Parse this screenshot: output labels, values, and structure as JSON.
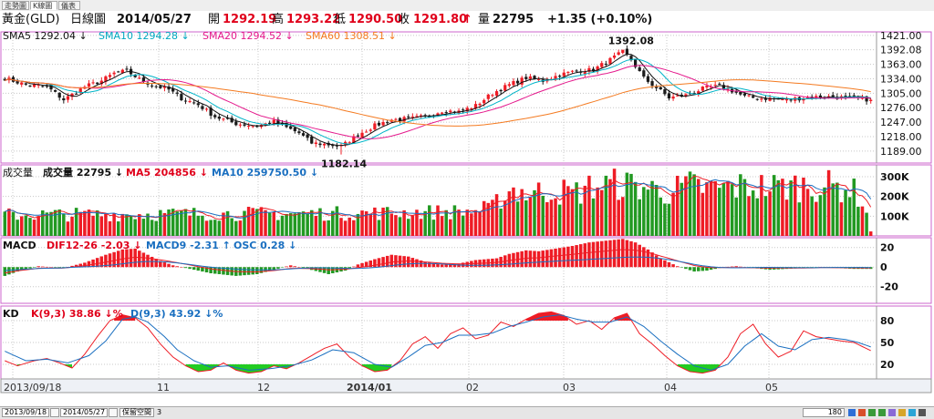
{
  "tabs": [
    "走勢圖",
    "K線圖",
    "儀表"
  ],
  "quote": {
    "name": "黃金(GLD)",
    "chart_type": "日線圖",
    "date": "2014/05/27",
    "open_label": "開",
    "open": "1292.19",
    "high_label": "高",
    "high": "1293.22",
    "low_label": "低",
    "low": "1290.50",
    "close_label": "收",
    "close": "1291.80",
    "volume_label": "量",
    "volume": "22795",
    "change": "+1.35 (+0.10%)"
  },
  "colors": {
    "up": "#ee1c25",
    "down": "#1a1a1a",
    "vol_up": "#ee1c25",
    "vol_down": "#229922",
    "sma5": "#111111",
    "sma10": "#00b4c8",
    "sma20": "#e4198c",
    "sma60": "#f47a20",
    "frame": "#cc66cc",
    "grid": "#c8c8c8"
  },
  "panels": {
    "price": {
      "legend": [
        {
          "text": "SMA5 1292.04",
          "arrow": "↓",
          "color": "#111111"
        },
        {
          "text": "SMA10 1294.28",
          "arrow": "↓",
          "color": "#00a8c0"
        },
        {
          "text": "SMA20 1294.52",
          "arrow": "↓",
          "color": "#e4198c"
        },
        {
          "text": "SMA60 1308.51",
          "arrow": "↓",
          "color": "#f47a20"
        }
      ],
      "high_label": "1392.08",
      "low_label": "1182.14"
    },
    "volume": {
      "title": "成交量",
      "legend": [
        {
          "text": "成交量 22795",
          "arrow": "↓",
          "color": "#111111"
        },
        {
          "text": "MA5 204856",
          "arrow": "↓",
          "color": "#e0001b"
        },
        {
          "text": "MA10 259750.50",
          "arrow": "↓",
          "color": "#1a6fc0"
        }
      ]
    },
    "macd": {
      "title": "MACD",
      "legend": [
        {
          "text": "DIF12-26 -2.03",
          "arrow": "↓",
          "color": "#e0001b"
        },
        {
          "text": "MACD9 -2.31",
          "arrow": "↑",
          "color": "#1a6fc0"
        },
        {
          "text": "OSC 0.28",
          "arrow": "↓",
          "color": "#1a6fc0"
        }
      ]
    },
    "kd": {
      "title": "KD",
      "legend": [
        {
          "text": "K(9,3) 38.86",
          "arrow": "↓%",
          "color": "#e0001b"
        },
        {
          "text": "D(9,3) 43.92",
          "arrow": "↓%",
          "color": "#1a6fc0"
        }
      ]
    }
  },
  "footer": {
    "start": "2013/09/18",
    "end": "2014/05/27",
    "button": "保留空間",
    "count": "3",
    "zoom": "180"
  },
  "chart_data": {
    "type": "candlestick",
    "x_tick_labels": [
      "2013/09/18",
      "11",
      "12",
      "2014/01",
      "02",
      "03",
      "04",
      "05"
    ],
    "price_axis": {
      "ticks": [
        1421.0,
        1392.08,
        1363.0,
        1334.0,
        1305.0,
        1276.0,
        1247.0,
        1218.0,
        1189.0
      ],
      "ylim": [
        1165,
        1428
      ]
    },
    "volume_axis": {
      "ticks": [
        "100K",
        "200K",
        "300K"
      ],
      "ylim": [
        0,
        360000
      ]
    },
    "macd_axis": {
      "ticks": [
        20,
        0,
        -20
      ],
      "ylim": [
        -37,
        30
      ]
    },
    "kd_axis": {
      "ticks": [
        20,
        50,
        80
      ],
      "ylim": [
        0,
        100
      ]
    },
    "close_anchors": [
      [
        0,
        1335
      ],
      [
        5,
        1322
      ],
      [
        10,
        1318
      ],
      [
        14,
        1292
      ],
      [
        19,
        1318
      ],
      [
        23,
        1330
      ],
      [
        26,
        1345
      ],
      [
        29,
        1350
      ],
      [
        32,
        1333
      ],
      [
        35,
        1322
      ],
      [
        39,
        1312
      ],
      [
        42,
        1295
      ],
      [
        46,
        1282
      ],
      [
        50,
        1258
      ],
      [
        55,
        1244
      ],
      [
        60,
        1239
      ],
      [
        64,
        1248
      ],
      [
        67,
        1236
      ],
      [
        70,
        1225
      ],
      [
        73,
        1205
      ],
      [
        77,
        1202
      ],
      [
        80,
        1198
      ],
      [
        84,
        1222
      ],
      [
        88,
        1240
      ],
      [
        92,
        1252
      ],
      [
        96,
        1254
      ],
      [
        100,
        1258
      ],
      [
        104,
        1270
      ],
      [
        108,
        1268
      ],
      [
        112,
        1280
      ],
      [
        116,
        1305
      ],
      [
        120,
        1322
      ],
      [
        124,
        1336
      ],
      [
        128,
        1330
      ],
      [
        132,
        1342
      ],
      [
        136,
        1350
      ],
      [
        140,
        1352
      ],
      [
        144,
        1372
      ],
      [
        147,
        1388
      ],
      [
        149,
        1372
      ],
      [
        152,
        1335
      ],
      [
        155,
        1316
      ],
      [
        158,
        1296
      ],
      [
        162,
        1301
      ],
      [
        166,
        1314
      ],
      [
        170,
        1320
      ],
      [
        173,
        1310
      ],
      [
        176,
        1298
      ],
      [
        179,
        1295
      ],
      [
        183,
        1294
      ],
      [
        186,
        1292
      ],
      [
        190,
        1296
      ],
      [
        194,
        1298
      ],
      [
        198,
        1297
      ],
      [
        202,
        1295
      ],
      [
        206,
        1292
      ]
    ],
    "volume_anchors": [
      [
        0,
        130000
      ],
      [
        40,
        135000
      ],
      [
        80,
        138000
      ],
      [
        110,
        150000
      ],
      [
        116,
        170000
      ],
      [
        118,
        240000
      ],
      [
        121,
        290000
      ],
      [
        125,
        255000
      ],
      [
        130,
        285000
      ],
      [
        135,
        260000
      ],
      [
        140,
        305000
      ],
      [
        146,
        320000
      ],
      [
        152,
        300000
      ],
      [
        158,
        270000
      ],
      [
        163,
        310000
      ],
      [
        168,
        290000
      ],
      [
        173,
        300000
      ],
      [
        178,
        305000
      ],
      [
        183,
        300000
      ],
      [
        190,
        310000
      ],
      [
        196,
        305000
      ],
      [
        201,
        295000
      ],
      [
        204,
        220000
      ],
      [
        205,
        130000
      ],
      [
        206,
        22795
      ]
    ],
    "macd_anchors": [
      [
        0,
        -10
      ],
      [
        3,
        -5
      ],
      [
        8,
        1
      ],
      [
        14,
        -1
      ],
      [
        19,
        5
      ],
      [
        24,
        14
      ],
      [
        28,
        20
      ],
      [
        31,
        21
      ],
      [
        34,
        14
      ],
      [
        37,
        7
      ],
      [
        40,
        2
      ],
      [
        44,
        -2
      ],
      [
        49,
        -7
      ],
      [
        55,
        -10
      ],
      [
        60,
        -8
      ],
      [
        64,
        -3
      ],
      [
        68,
        2
      ],
      [
        72,
        -2
      ],
      [
        77,
        -8
      ],
      [
        81,
        -4
      ],
      [
        84,
        3
      ],
      [
        88,
        9
      ],
      [
        92,
        14
      ],
      [
        96,
        12
      ],
      [
        100,
        6
      ],
      [
        104,
        3
      ],
      [
        108,
        4
      ],
      [
        112,
        8
      ],
      [
        117,
        10
      ],
      [
        120,
        15
      ],
      [
        124,
        19
      ],
      [
        127,
        18
      ],
      [
        131,
        21
      ],
      [
        135,
        24
      ],
      [
        139,
        28
      ],
      [
        143,
        30
      ],
      [
        147,
        32
      ],
      [
        150,
        28
      ],
      [
        153,
        20
      ],
      [
        156,
        10
      ],
      [
        160,
        1
      ],
      [
        164,
        -5
      ],
      [
        167,
        -4
      ],
      [
        171,
        0
      ],
      [
        174,
        1
      ],
      [
        178,
        -1
      ],
      [
        182,
        -3
      ],
      [
        186,
        -2
      ],
      [
        190,
        -1
      ],
      [
        194,
        0
      ],
      [
        198,
        -1
      ],
      [
        202,
        -2
      ],
      [
        206,
        -2.03
      ]
    ],
    "k_anchors": [
      [
        0,
        25
      ],
      [
        3,
        18
      ],
      [
        7,
        25
      ],
      [
        10,
        28
      ],
      [
        13,
        22
      ],
      [
        16,
        15
      ],
      [
        19,
        34
      ],
      [
        22,
        58
      ],
      [
        25,
        80
      ],
      [
        28,
        88
      ],
      [
        31,
        84
      ],
      [
        34,
        70
      ],
      [
        37,
        48
      ],
      [
        40,
        30
      ],
      [
        43,
        18
      ],
      [
        46,
        10
      ],
      [
        49,
        12
      ],
      [
        52,
        22
      ],
      [
        55,
        12
      ],
      [
        58,
        8
      ],
      [
        61,
        10
      ],
      [
        64,
        18
      ],
      [
        67,
        14
      ],
      [
        70,
        22
      ],
      [
        73,
        32
      ],
      [
        76,
        42
      ],
      [
        79,
        48
      ],
      [
        82,
        30
      ],
      [
        85,
        18
      ],
      [
        88,
        10
      ],
      [
        91,
        12
      ],
      [
        94,
        25
      ],
      [
        97,
        48
      ],
      [
        100,
        58
      ],
      [
        103,
        42
      ],
      [
        106,
        62
      ],
      [
        109,
        70
      ],
      [
        112,
        55
      ],
      [
        115,
        60
      ],
      [
        118,
        78
      ],
      [
        121,
        72
      ],
      [
        124,
        82
      ],
      [
        127,
        90
      ],
      [
        130,
        92
      ],
      [
        133,
        87
      ],
      [
        136,
        75
      ],
      [
        139,
        80
      ],
      [
        142,
        68
      ],
      [
        145,
        84
      ],
      [
        148,
        90
      ],
      [
        151,
        62
      ],
      [
        154,
        48
      ],
      [
        157,
        32
      ],
      [
        160,
        18
      ],
      [
        163,
        10
      ],
      [
        166,
        8
      ],
      [
        169,
        12
      ],
      [
        172,
        30
      ],
      [
        175,
        62
      ],
      [
        178,
        75
      ],
      [
        181,
        48
      ],
      [
        184,
        30
      ],
      [
        187,
        38
      ],
      [
        190,
        66
      ],
      [
        193,
        58
      ],
      [
        196,
        55
      ],
      [
        199,
        52
      ],
      [
        202,
        50
      ],
      [
        206,
        38.86
      ]
    ],
    "d_anchors": [
      [
        0,
        38
      ],
      [
        5,
        25
      ],
      [
        10,
        27
      ],
      [
        15,
        22
      ],
      [
        20,
        32
      ],
      [
        24,
        52
      ],
      [
        28,
        82
      ],
      [
        31,
        85
      ],
      [
        34,
        78
      ],
      [
        38,
        58
      ],
      [
        41,
        40
      ],
      [
        45,
        25
      ],
      [
        49,
        16
      ],
      [
        53,
        18
      ],
      [
        58,
        12
      ],
      [
        63,
        14
      ],
      [
        68,
        18
      ],
      [
        73,
        26
      ],
      [
        78,
        40
      ],
      [
        83,
        36
      ],
      [
        88,
        20
      ],
      [
        92,
        16
      ],
      [
        96,
        30
      ],
      [
        100,
        46
      ],
      [
        104,
        50
      ],
      [
        108,
        60
      ],
      [
        112,
        60
      ],
      [
        116,
        63
      ],
      [
        120,
        72
      ],
      [
        124,
        78
      ],
      [
        128,
        85
      ],
      [
        132,
        88
      ],
      [
        136,
        82
      ],
      [
        140,
        78
      ],
      [
        144,
        78
      ],
      [
        148,
        85
      ],
      [
        152,
        72
      ],
      [
        156,
        52
      ],
      [
        160,
        34
      ],
      [
        164,
        18
      ],
      [
        168,
        12
      ],
      [
        172,
        20
      ],
      [
        176,
        45
      ],
      [
        180,
        62
      ],
      [
        184,
        45
      ],
      [
        188,
        40
      ],
      [
        192,
        54
      ],
      [
        196,
        57
      ],
      [
        200,
        54
      ],
      [
        203,
        50
      ],
      [
        206,
        43.92
      ]
    ],
    "n": 207
  }
}
